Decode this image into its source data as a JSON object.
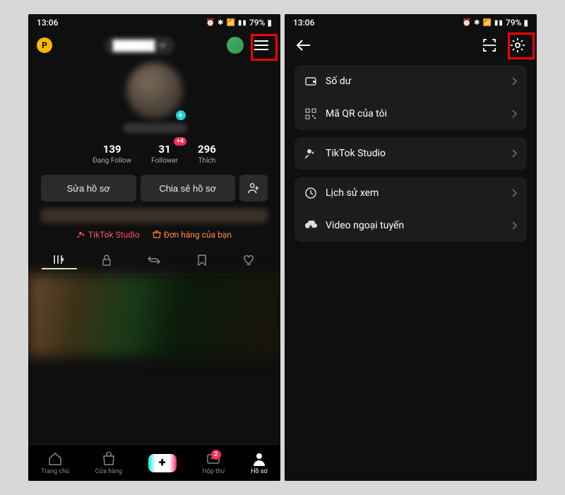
{
  "status": {
    "time": "13:06",
    "battery_pct": "79%"
  },
  "left": {
    "badge_letter": "P",
    "avatar_plus": "+",
    "stats": [
      {
        "num": "139",
        "label": "Đang Follow"
      },
      {
        "num": "31",
        "label": "Follower",
        "badge": "+4"
      },
      {
        "num": "296",
        "label": "Thích"
      }
    ],
    "buttons": {
      "edit": "Sửa hồ sơ",
      "share": "Chia sẻ hồ sơ"
    },
    "links": {
      "studio": "TikTok Studio",
      "orders": "Đơn hàng của bạn"
    },
    "nav": {
      "home": "Trang chủ",
      "shop": "Cửa hàng",
      "inbox": "Hộp thư",
      "inbox_badge": "2",
      "profile": "Hồ sơ"
    }
  },
  "right": {
    "items": {
      "balance": "Số dư",
      "qr": "Mã QR của tôi",
      "studio": "TikTok Studio",
      "history": "Lịch sử xem",
      "offline": "Video ngoại tuyến"
    }
  }
}
